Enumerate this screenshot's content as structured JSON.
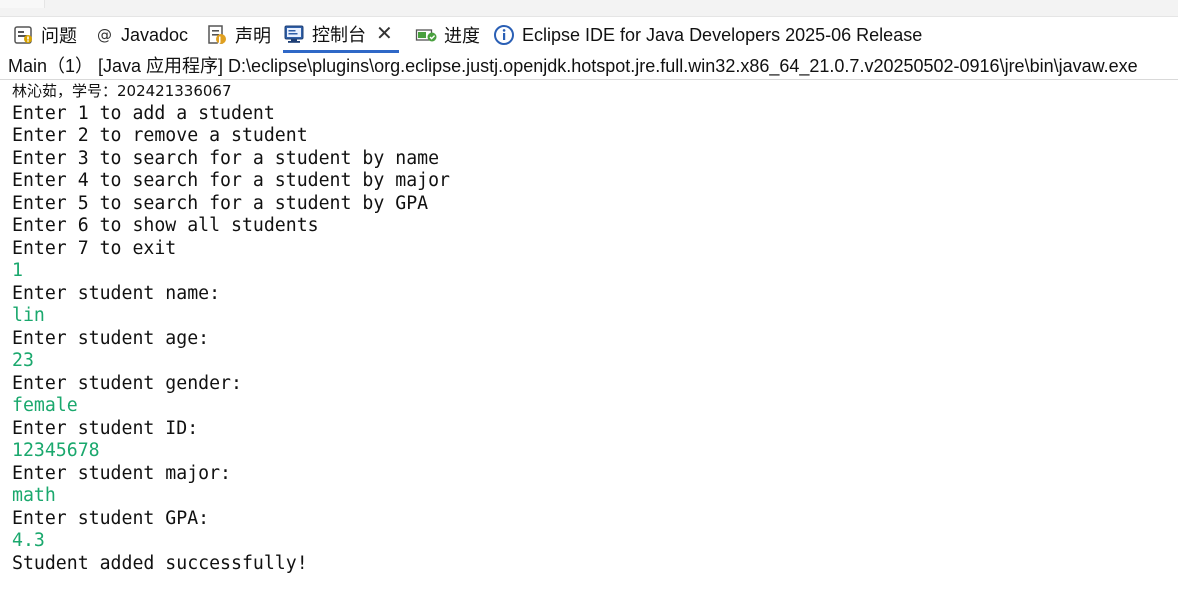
{
  "tabs": [
    {
      "label": "问题",
      "icon": "problems-icon"
    },
    {
      "label": "Javadoc",
      "icon": "at-sign-icon"
    },
    {
      "label": "声明",
      "icon": "declaration-icon"
    },
    {
      "label": "控制台",
      "icon": "console-icon",
      "active": true
    },
    {
      "label": "进度",
      "icon": "progress-icon"
    },
    {
      "label": "Eclipse IDE for Java Developers 2025-06 Release",
      "icon": "info-icon"
    }
  ],
  "console_header": "Main（1） [Java 应用程序] D:\\eclipse\\plugins\\org.eclipse.justj.openjdk.hotspot.jre.full.win32.x86_64_21.0.7.v20250502-0916\\jre\\bin\\javaw.exe",
  "colors": {
    "user_input": "#1aa86d",
    "active_tab_underline": "#2f68c7",
    "info_icon": "#2a5fb5"
  },
  "console_lines": [
    {
      "text": "林沁茹，学号：202421336067",
      "type": "output"
    },
    {
      "text": "Enter 1 to add a student",
      "type": "output"
    },
    {
      "text": "Enter 2 to remove a student",
      "type": "output"
    },
    {
      "text": "Enter 3 to search for a student by name",
      "type": "output"
    },
    {
      "text": "Enter 4 to search for a student by major",
      "type": "output"
    },
    {
      "text": "Enter 5 to search for a student by GPA",
      "type": "output"
    },
    {
      "text": "Enter 6 to show all students",
      "type": "output"
    },
    {
      "text": "Enter 7 to exit",
      "type": "output"
    },
    {
      "text": "1",
      "type": "input"
    },
    {
      "text": "Enter student name:",
      "type": "output"
    },
    {
      "text": "lin",
      "type": "input"
    },
    {
      "text": "Enter student age:",
      "type": "output"
    },
    {
      "text": "23",
      "type": "input"
    },
    {
      "text": "Enter student gender:",
      "type": "output"
    },
    {
      "text": "female",
      "type": "input"
    },
    {
      "text": "Enter student ID:",
      "type": "output"
    },
    {
      "text": "12345678",
      "type": "input"
    },
    {
      "text": "Enter student major:",
      "type": "output"
    },
    {
      "text": "math",
      "type": "input"
    },
    {
      "text": "Enter student GPA:",
      "type": "output"
    },
    {
      "text": "4.3",
      "type": "input"
    },
    {
      "text": "Student added successfully!",
      "type": "output"
    }
  ]
}
